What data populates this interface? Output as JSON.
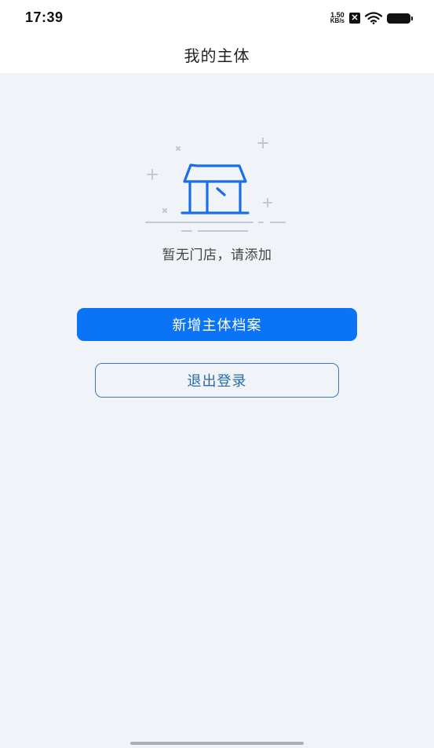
{
  "status_bar": {
    "time": "17:39",
    "net_speed_value": "1.50",
    "net_speed_unit": "KB/s",
    "sim_status": "✕",
    "icons": [
      "sim-off-icon",
      "wifi-icon",
      "battery-icon"
    ]
  },
  "nav": {
    "title": "我的主体"
  },
  "empty_state": {
    "icon": "store-icon",
    "message": "暂无门店，请添加"
  },
  "actions": {
    "add_label": "新增主体档案",
    "logout_label": "退出登录"
  },
  "colors": {
    "primary": "#0a73f6",
    "secondary_border": "#3d78b5",
    "background": "#f0f4f8",
    "icon_blue": "#1a6fe8"
  }
}
